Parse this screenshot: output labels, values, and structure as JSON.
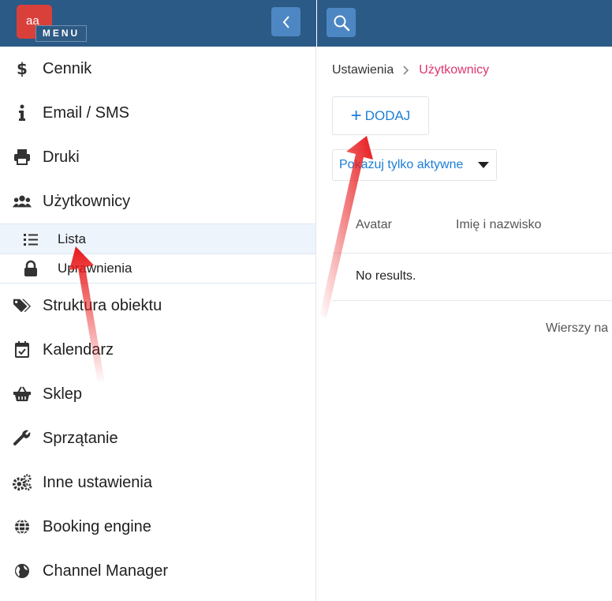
{
  "header": {
    "logo_text": "aa",
    "menu_label": "MENU"
  },
  "sidebar": {
    "items": [
      {
        "label": "Cennik",
        "icon": "dollar-icon"
      },
      {
        "label": "Email / SMS",
        "icon": "info-icon"
      },
      {
        "label": "Druki",
        "icon": "printer-icon"
      },
      {
        "label": "Użytkownicy",
        "icon": "users-icon"
      }
    ],
    "subitems": [
      {
        "label": "Lista",
        "icon": "list-icon",
        "active": true
      },
      {
        "label": "Uprawnienia",
        "icon": "lock-icon",
        "active": false
      }
    ],
    "items_after": [
      {
        "label": "Struktura obiektu",
        "icon": "tags-icon"
      },
      {
        "label": "Kalendarz",
        "icon": "calendar-check-icon"
      },
      {
        "label": "Sklep",
        "icon": "basket-icon"
      },
      {
        "label": "Sprzątanie",
        "icon": "wrench-icon"
      },
      {
        "label": "Inne ustawienia",
        "icon": "cogs-icon"
      },
      {
        "label": "Booking engine",
        "icon": "globe-icon"
      },
      {
        "label": "Channel Manager",
        "icon": "globe-americas-icon"
      }
    ]
  },
  "breadcrumb": {
    "parent": "Ustawienia",
    "current": "Użytkownicy"
  },
  "toolbar": {
    "add_label": "DODAJ",
    "filter_label": "Pokazuj tylko aktywne"
  },
  "table": {
    "columns": [
      "Avatar",
      "Imię i nazwisko"
    ],
    "empty_text": "No results.",
    "rows_per_page_label": "Wierszy na"
  },
  "colors": {
    "header_bg": "#2b5a86",
    "button_bg": "#4d87c3",
    "accent_blue": "#1c7ed6",
    "breadcrumb_current": "#e0356c",
    "arrow_red": "#e8191b",
    "logo_red": "#d9403a"
  }
}
